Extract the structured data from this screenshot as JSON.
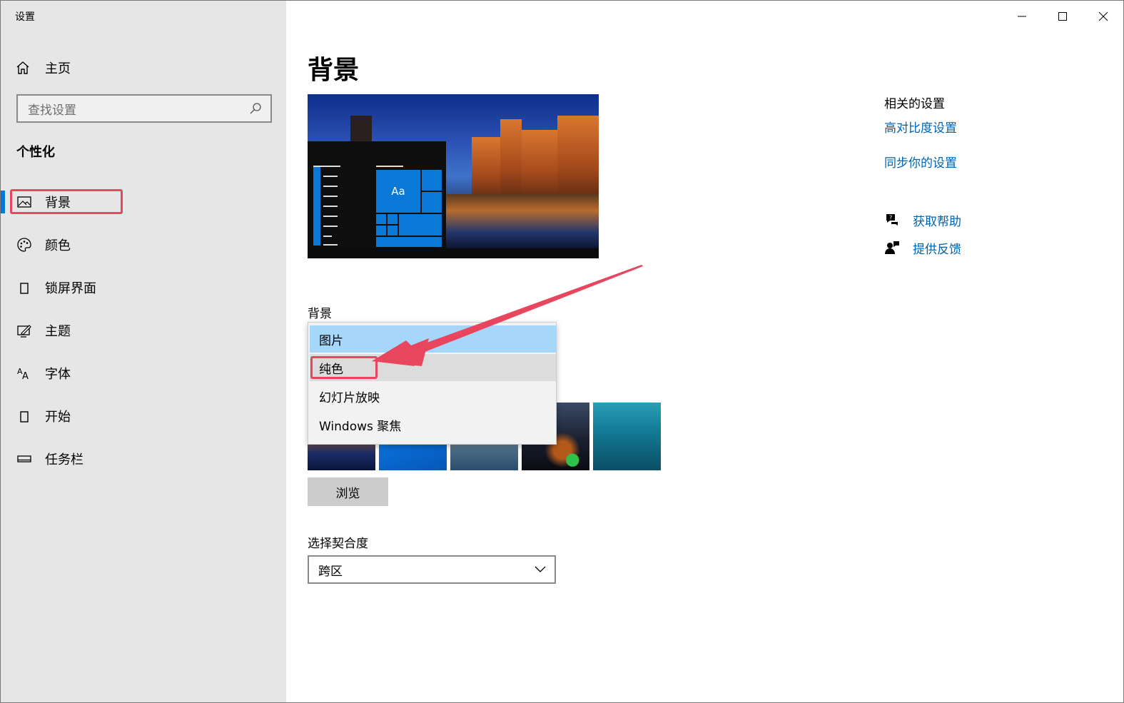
{
  "window": {
    "title": "设置"
  },
  "sidebar": {
    "home_label": "主页",
    "search_placeholder": "查找设置",
    "section_title": "个性化",
    "items": [
      {
        "label": "背景",
        "icon": "image-icon",
        "active": true
      },
      {
        "label": "颜色",
        "icon": "palette-icon"
      },
      {
        "label": "锁屏界面",
        "icon": "lock-screen-icon"
      },
      {
        "label": "主题",
        "icon": "theme-icon"
      },
      {
        "label": "字体",
        "icon": "font-icon"
      },
      {
        "label": "开始",
        "icon": "start-icon"
      },
      {
        "label": "任务栏",
        "icon": "taskbar-icon"
      }
    ]
  },
  "main": {
    "title": "背景",
    "preview_tile_text": "Aa",
    "background_label": "背景",
    "background_options": [
      {
        "label": "图片",
        "state": "selected"
      },
      {
        "label": "纯色",
        "state": "hover"
      },
      {
        "label": "幻灯片放映"
      },
      {
        "label": "Windows 聚焦"
      }
    ],
    "browse_label": "浏览",
    "fit_label": "选择契合度",
    "fit_value": "跨区"
  },
  "related": {
    "title": "相关的设置",
    "links": [
      "高对比度设置",
      "同步你的设置"
    ]
  },
  "help": {
    "get_help": "获取帮助",
    "feedback": "提供反馈"
  },
  "colors": {
    "accent": "#0078d7",
    "link": "#0063b1",
    "annotation": "#e8465f",
    "sidebar_bg": "#e6e6e6",
    "selected_option": "#a7d6fb"
  }
}
